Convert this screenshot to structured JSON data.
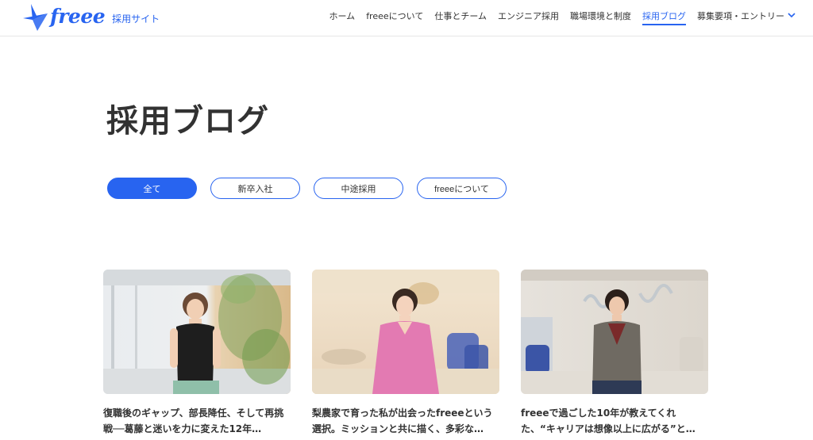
{
  "header": {
    "logo_text": "freee",
    "logo_sub": "採用サイト",
    "nav": [
      {
        "label": "ホーム"
      },
      {
        "label": "freeeについて"
      },
      {
        "label": "仕事とチーム"
      },
      {
        "label": "エンジニア採用"
      },
      {
        "label": "職場環境と制度"
      },
      {
        "label": "採用ブログ"
      },
      {
        "label": "募集要項・エントリー"
      }
    ],
    "active_nav": "採用ブログ"
  },
  "main": {
    "title": "採用ブログ",
    "filters": [
      {
        "label": "全て"
      },
      {
        "label": "新卒入社"
      },
      {
        "label": "中途採用"
      },
      {
        "label": "freeeについて"
      }
    ],
    "active_filter": "全て",
    "cards": [
      {
        "title": "復職後のギャップ、部長降任、そして再挑戦──葛藤と迷いを力に変えた12年…"
      },
      {
        "title": "梨農家で育った私が出会ったfreeeという選択。ミッションと共に描く、多彩な…"
      },
      {
        "title": "freeeで過ごした10年が教えてくれた、“キャリアは想像以上に広がる”と…"
      }
    ]
  },
  "colors": {
    "brand": "#2864f0",
    "text": "#323232",
    "divider": "#e6e6e6"
  },
  "icons": {
    "logo": "freee-bird-logo",
    "nav_dropdown": "chevron-down-icon"
  }
}
